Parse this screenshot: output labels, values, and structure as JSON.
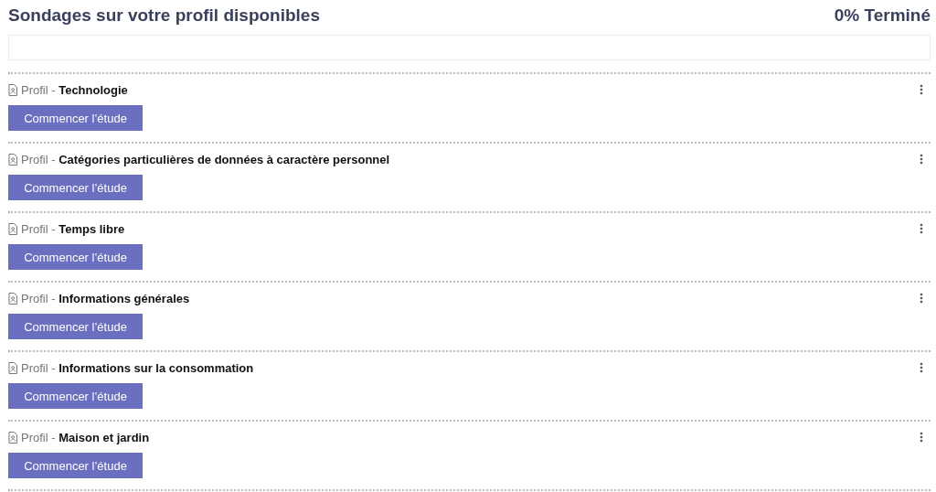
{
  "header": {
    "title": "Sondages sur votre profil disponibles",
    "progress_text": "0% Terminé"
  },
  "progress": {
    "level": 0
  },
  "surveys": [
    {
      "label": "Profil - **Technologie**",
      "button": "Commencer l’étude"
    },
    {
      "label": "Profil - **Catégories particulières de données à caractère personnel**",
      "button": "Commencer l’étude"
    },
    {
      "label": "Profil - **Temps libre**",
      "button": "Commencer l’étude"
    },
    {
      "label": "Profil - **Informations générales**",
      "button": "Commencer l’étude"
    },
    {
      "label": "Profil - **Informations sur la consommation**",
      "button": "Commencer l’étude"
    },
    {
      "label": "Profil - **Maison et jardin**",
      "button": "Commencer l’étude"
    }
  ]
}
